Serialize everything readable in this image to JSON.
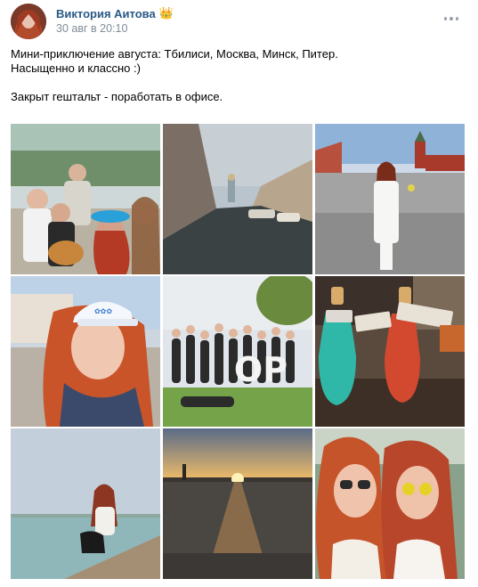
{
  "post": {
    "author": "Виктория Аитова",
    "author_badge_icon": "crown-icon",
    "date": "30 авг в 20:10",
    "text_lines": [
      "Мини-приключение августа: Tбилиси, Москва, Минск, Питер.",
      "Насыщенно и классно :)",
      "",
      "Закрыт гештальт - поработать в офисе."
    ]
  },
  "gallery": {
    "photos": [
      {
        "subject": "group-of-friends-with-dog"
      },
      {
        "subject": "saint-petersburg-canal"
      },
      {
        "subject": "red-square-moscow"
      },
      {
        "subject": "woman-in-cap-selfie"
      },
      {
        "subject": "office-team-photo"
      },
      {
        "subject": "two-drink-bottles"
      },
      {
        "subject": "woman-on-pier-by-water"
      },
      {
        "subject": "sunset-over-sea"
      },
      {
        "subject": "two-women-selfie-sunglasses"
      }
    ]
  }
}
